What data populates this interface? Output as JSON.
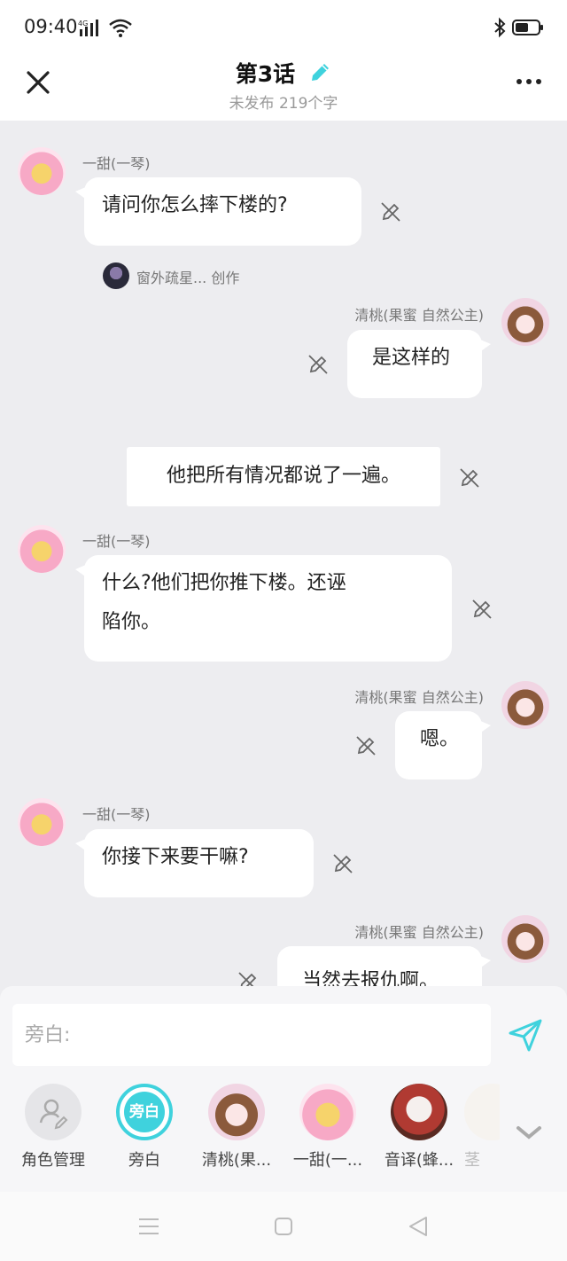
{
  "status_bar": {
    "time": "09:40",
    "network": "4G"
  },
  "header": {
    "title": "第3话",
    "subtitle": "未发布 219个字"
  },
  "messages": [
    {
      "type": "left",
      "name": "一甜(一琴)",
      "text": "请问你怎么摔下楼的?"
    },
    {
      "type": "creator",
      "text": "窗外疏星... 创作"
    },
    {
      "type": "right",
      "name": "清桃(果蜜  自然公主)",
      "text": "是这样的"
    },
    {
      "type": "narration",
      "text": "他把所有情况都说了一遍。"
    },
    {
      "type": "left",
      "name": "一甜(一琴)",
      "line1": "什么?他们把你推下楼。还诬",
      "line2": "陷你。"
    },
    {
      "type": "right",
      "name": "清桃(果蜜  自然公主)",
      "text": "嗯。"
    },
    {
      "type": "left",
      "name": "一甜(一琴)",
      "text": "你接下来要干嘛?"
    },
    {
      "type": "right",
      "name": "清桃(果蜜  自然公主)",
      "text": "当然去报仇啊。"
    }
  ],
  "input": {
    "placeholder": "旁白:"
  },
  "roles": [
    {
      "label": "角色管理",
      "icon": "person-edit-icon"
    },
    {
      "label": "旁白",
      "badge": "旁白"
    },
    {
      "label": "清桃(果..."
    },
    {
      "label": "一甜(一..."
    },
    {
      "label": "音译(蜂..."
    },
    {
      "label": "茎"
    }
  ],
  "colors": {
    "accent": "#3fd2dd",
    "bubble": "#ffffff",
    "background": "#ededf0"
  }
}
